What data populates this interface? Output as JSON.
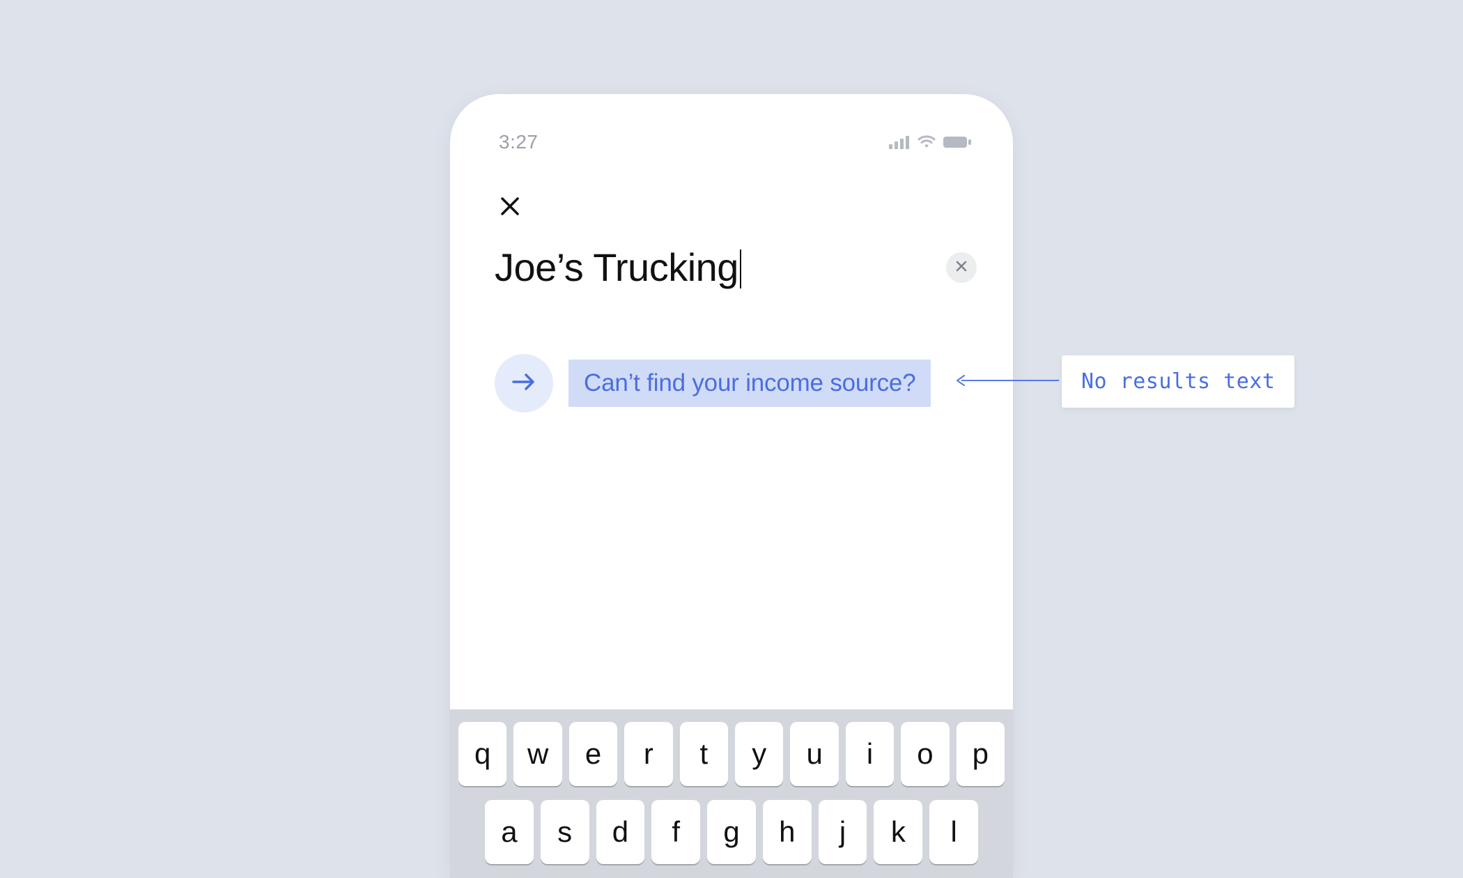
{
  "status": {
    "time": "3:27"
  },
  "search": {
    "value": "Joe’s Trucking"
  },
  "no_results": {
    "link_text": "Can’t find your income source?"
  },
  "keyboard": {
    "row1": [
      "q",
      "w",
      "e",
      "r",
      "t",
      "y",
      "u",
      "i",
      "o",
      "p"
    ],
    "row2": [
      "a",
      "s",
      "d",
      "f",
      "g",
      "h",
      "j",
      "k",
      "l"
    ]
  },
  "annotation": {
    "label": "No results text"
  }
}
